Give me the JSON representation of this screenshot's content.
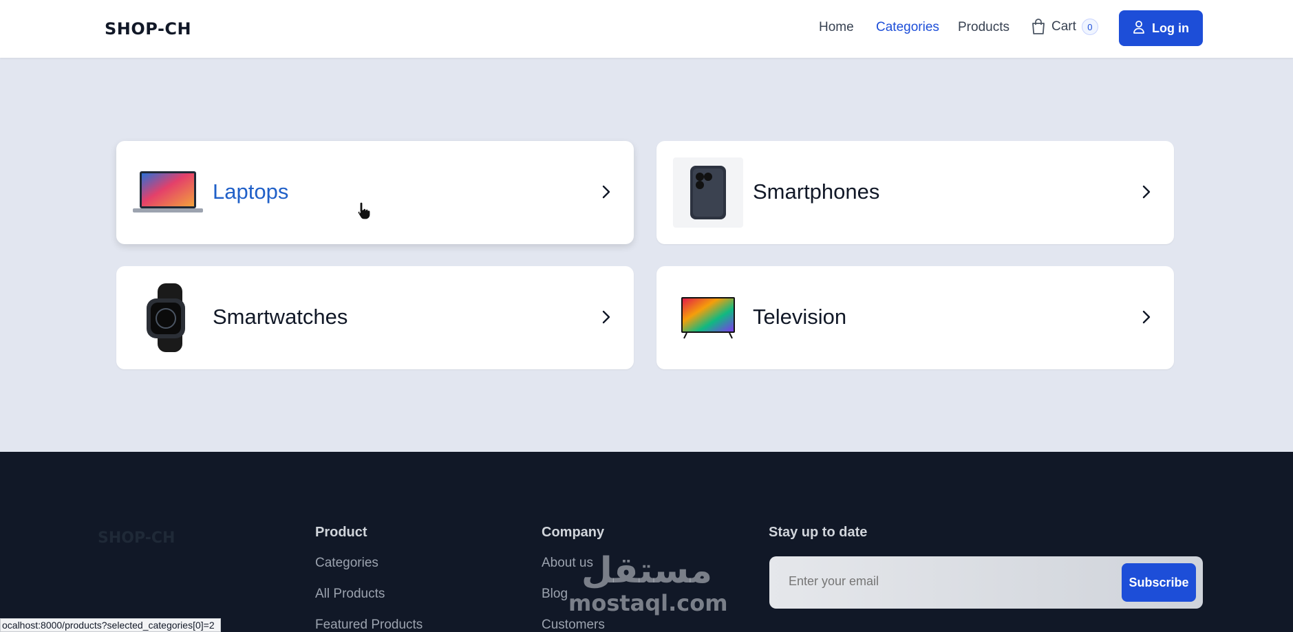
{
  "header": {
    "logo": "SHOP-CH",
    "nav": {
      "home": "Home",
      "categories": "Categories",
      "products": "Products"
    },
    "cart": {
      "label": "Cart",
      "count": "0"
    },
    "login_label": "Log in"
  },
  "categories": [
    {
      "name": "Laptops",
      "thumb_icon": "laptop-image"
    },
    {
      "name": "Smartphones",
      "thumb_icon": "smartphone-image"
    },
    {
      "name": "Smartwatches",
      "thumb_icon": "smartwatch-image"
    },
    {
      "name": "Television",
      "thumb_icon": "television-image"
    }
  ],
  "footer": {
    "logo": "SHOP-CH",
    "product": {
      "heading": "Product",
      "links": [
        "Categories",
        "All Products",
        "Featured Products"
      ]
    },
    "company": {
      "heading": "Company",
      "links": [
        "About us",
        "Blog",
        "Customers"
      ]
    },
    "newsletter": {
      "heading": "Stay up to date",
      "placeholder": "Enter your email",
      "button": "Subscribe"
    }
  },
  "watermark": {
    "arabic": "مستقل",
    "latin": "mostaql.com"
  },
  "status_url": "ocalhost:8000/products?selected_categories[0]=2",
  "colors": {
    "accent": "#1d4ed8",
    "highlight_text": "#2060c8",
    "footer_bg": "#111827",
    "page_bg": "#e2e6f0"
  }
}
